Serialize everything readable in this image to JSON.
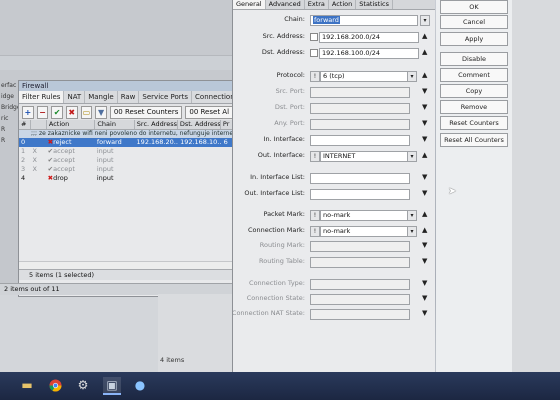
{
  "side_panel": {
    "items": [
      "erfac",
      "idge",
      "Bridge",
      "ric",
      "R",
      "R"
    ]
  },
  "firewall": {
    "title": "Firewall",
    "tabs": [
      "Filter Rules",
      "NAT",
      "Mangle",
      "Raw",
      "Service Ports",
      "Connections",
      "Ad"
    ],
    "reset_counters": "00 Reset Counters",
    "reset_all_counters": "00 Reset Al",
    "columns": [
      "#",
      "Action",
      "Chain",
      "Src. Address",
      "Dst. Address",
      "Pr"
    ],
    "comment": ";;; ze zakaznicke wifi neni povoleno do internetu, nefunguje internetí ping",
    "rows": [
      {
        "num": "0",
        "flag": "",
        "action": "reject",
        "chain": "forward",
        "src": "192.168.20...",
        "dst": "192.168.10...",
        "proto": "6"
      },
      {
        "num": "1",
        "flag": "X",
        "action": "accept",
        "chain": "input",
        "src": "",
        "dst": "",
        "proto": ""
      },
      {
        "num": "2",
        "flag": "X",
        "action": "accept",
        "chain": "input",
        "src": "",
        "dst": "",
        "proto": ""
      },
      {
        "num": "3",
        "flag": "X",
        "action": "accept",
        "chain": "input",
        "src": "",
        "dst": "",
        "proto": ""
      },
      {
        "num": "4",
        "flag": "",
        "action": "drop",
        "chain": "input",
        "src": "",
        "dst": "",
        "proto": ""
      }
    ],
    "status": "5 items (1 selected)"
  },
  "bg_status": "2 items out of 11",
  "items_count": "4 items",
  "rule_dialog": {
    "tabs": [
      "General",
      "Advanced",
      "Extra",
      "Action",
      "Statistics"
    ],
    "fields": {
      "chain": {
        "label": "Chain:",
        "value": "forward"
      },
      "src_address": {
        "label": "Src. Address:",
        "value": "192.168.200.0/24"
      },
      "dst_address": {
        "label": "Dst. Address:",
        "value": "192.168.100.0/24"
      },
      "protocol": {
        "label": "Protocol:",
        "value": "6 (tcp)"
      },
      "src_port": {
        "label": "Src. Port:",
        "value": ""
      },
      "dst_port": {
        "label": "Dst. Port:",
        "value": ""
      },
      "any_port": {
        "label": "Any. Port:",
        "value": ""
      },
      "in_interface": {
        "label": "In. Interface:",
        "value": ""
      },
      "out_interface": {
        "label": "Out. Interface:",
        "value": "INTERNET"
      },
      "in_interface_list": {
        "label": "In. Interface List:",
        "value": ""
      },
      "out_interface_list": {
        "label": "Out. Interface List:",
        "value": ""
      },
      "packet_mark": {
        "label": "Packet Mark:",
        "value": "no-mark"
      },
      "connection_mark": {
        "label": "Connection Mark:",
        "value": "no-mark"
      },
      "routing_mark": {
        "label": "Routing Mark:",
        "value": ""
      },
      "routing_table": {
        "label": "Routing Table:",
        "value": ""
      },
      "connection_type": {
        "label": "Connection Type:",
        "value": ""
      },
      "connection_state": {
        "label": "Connection State:",
        "value": ""
      },
      "connection_nat_state": {
        "label": "Connection NAT State:",
        "value": ""
      }
    }
  },
  "buttons": [
    "OK",
    "Cancel",
    "Apply",
    "Disable",
    "Comment",
    "Copy",
    "Remove",
    "Reset Counters",
    "Reset All Counters"
  ]
}
